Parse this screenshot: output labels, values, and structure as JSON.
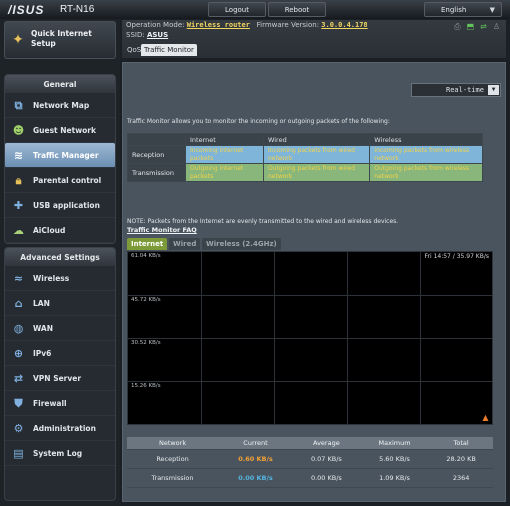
{
  "header": {
    "brand": "/ISUS",
    "model": "RT-N16",
    "logout_label": "Logout",
    "reboot_label": "Reboot",
    "language": "English"
  },
  "sidebar": {
    "quick_setup": "Quick Internet Setup",
    "general_title": "General",
    "general_items": [
      {
        "label": "Network Map",
        "icon": "network-map-icon"
      },
      {
        "label": "Guest Network",
        "icon": "guest-network-icon"
      },
      {
        "label": "Traffic Manager",
        "icon": "traffic-manager-icon",
        "active": true
      },
      {
        "label": "Parental control",
        "icon": "lock-icon"
      },
      {
        "label": "USB application",
        "icon": "puzzle-icon"
      },
      {
        "label": "AiCloud",
        "icon": "cloud-icon"
      }
    ],
    "advanced_title": "Advanced Settings",
    "advanced_items": [
      {
        "label": "Wireless",
        "icon": "wifi-icon"
      },
      {
        "label": "LAN",
        "icon": "home-icon"
      },
      {
        "label": "WAN",
        "icon": "globe-icon"
      },
      {
        "label": "IPv6",
        "icon": "ipv6-icon"
      },
      {
        "label": "VPN Server",
        "icon": "vpn-icon"
      },
      {
        "label": "Firewall",
        "icon": "shield-icon"
      },
      {
        "label": "Administration",
        "icon": "admin-icon"
      },
      {
        "label": "System Log",
        "icon": "log-icon"
      }
    ]
  },
  "info": {
    "opmode_label": "Operation Mode:",
    "opmode_value": "Wireless router",
    "firmware_label": "Firmware Version:",
    "firmware_value": "3.0.0.4.178",
    "ssid_label": "SSID:",
    "ssid_value": "ASUS",
    "tabs": [
      "QoS",
      "Traffic Monitor"
    ]
  },
  "monitor": {
    "mode_select": "Real-time",
    "description": "Traffic Monitor allows you to monitor the incoming or outgoing packets of the following:",
    "legend": {
      "col_internet": "Internet",
      "col_wired": "Wired",
      "col_wireless": "Wireless",
      "row_reception": "Reception",
      "row_transmission": "Transmission",
      "rx_internet": "Incoming internet packets",
      "rx_wired": "Incoming packets from wired network",
      "rx_wireless": "Incoming packets from wireless network",
      "tx_internet": "Outgoing internet packets",
      "tx_wired": "Outgoing packets from wired network",
      "tx_wireless": "Outgoing packets from wireless network"
    },
    "note": "NOTE: Packets from the Internet are evenly transmitted to the wired and wireless devices.",
    "faq": "Traffic Monitor FAQ",
    "graph_tabs": [
      "Internet",
      "Wired",
      "Wireless (2.4GHz)"
    ],
    "graph": {
      "y_labels": [
        "61.04 KB/s",
        "45.72 KB/s",
        "30.52 KB/s",
        "15.26 KB/s"
      ],
      "timestamp": "Fri 14:57 / 35.97 KB/s"
    },
    "stats": {
      "headers": [
        "Network",
        "Current",
        "Average",
        "Maximum",
        "Total"
      ],
      "rows": [
        {
          "network": "Reception",
          "current": "0.60 KB/s",
          "average": "0.07 KB/s",
          "maximum": "5.60 KB/s",
          "total": "28.20 KB"
        },
        {
          "network": "Transmission",
          "current": "0.00 KB/s",
          "average": "0.00 KB/s",
          "maximum": "1.09 KB/s",
          "total": "2364"
        }
      ]
    }
  },
  "colors": {
    "active_nav": "#7fa3c6",
    "reception": "#f3a136",
    "transmission": "#54b4e0",
    "internet_tab": "#7d9a38"
  }
}
